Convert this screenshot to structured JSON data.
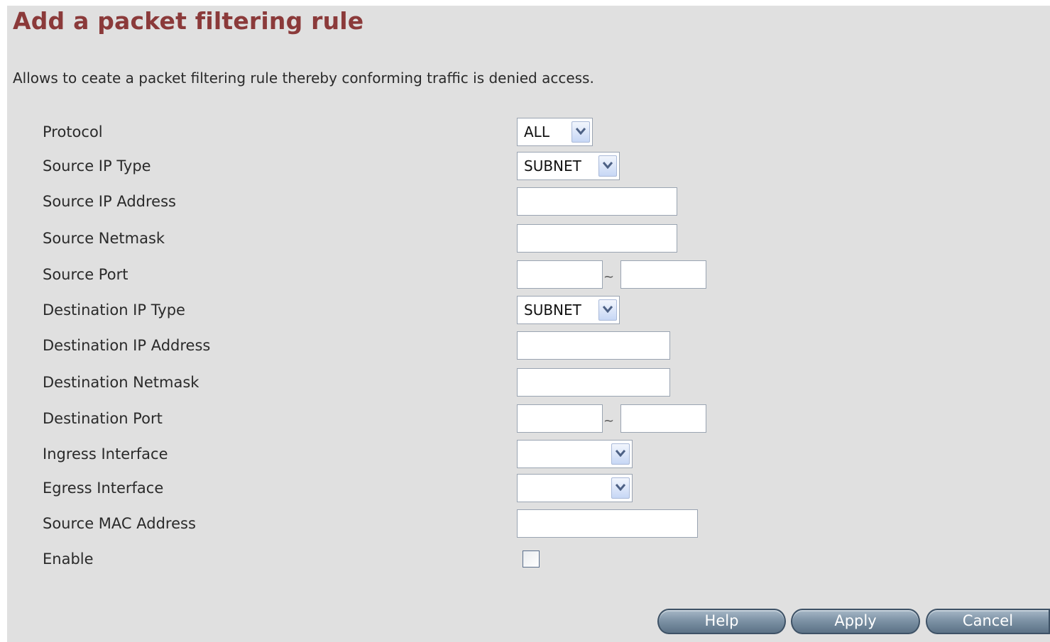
{
  "page": {
    "title": "Add a packet filtering rule",
    "description": "Allows to ceate a packet filtering rule thereby conforming traffic is denied access."
  },
  "fields": {
    "protocol": {
      "label": "Protocol",
      "value": "ALL"
    },
    "source_ip_type": {
      "label": "Source IP Type",
      "value": "SUBNET"
    },
    "source_ip_address": {
      "label": "Source IP Address",
      "value": ""
    },
    "source_netmask": {
      "label": "Source Netmask",
      "value": ""
    },
    "source_port": {
      "label": "Source Port",
      "start": "",
      "end": "",
      "separator": "~"
    },
    "destination_ip_type": {
      "label": "Destination IP Type",
      "value": "SUBNET"
    },
    "destination_ip_address": {
      "label": "Destination IP Address",
      "value": ""
    },
    "destination_netmask": {
      "label": "Destination Netmask",
      "value": ""
    },
    "destination_port": {
      "label": "Destination Port",
      "start": "",
      "end": "",
      "separator": "~"
    },
    "ingress_interface": {
      "label": "Ingress Interface",
      "value": ""
    },
    "egress_interface": {
      "label": "Egress Interface",
      "value": ""
    },
    "source_mac_address": {
      "label": "Source MAC Address",
      "value": ""
    },
    "enable": {
      "label": "Enable",
      "checked": false
    }
  },
  "buttons": {
    "help": "Help",
    "apply": "Apply",
    "cancel": "Cancel"
  },
  "colors": {
    "title": "#8b3a3a",
    "panel_background": "#e0e0e0",
    "button_fill": "#7e93a6"
  },
  "icons": {
    "dropdown": "chevron-down-icon"
  }
}
